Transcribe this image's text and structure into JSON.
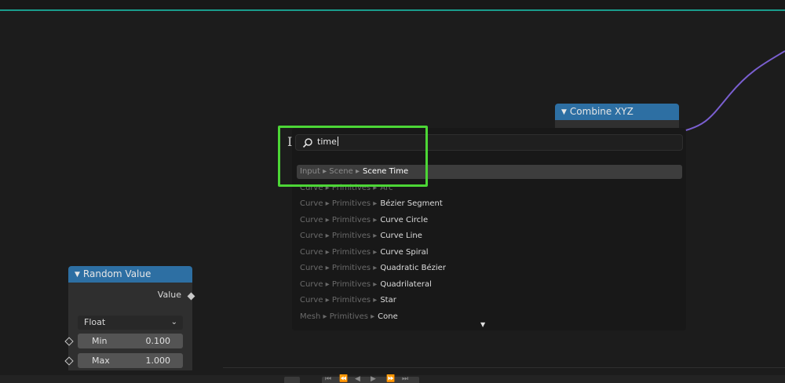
{
  "colors": {
    "node_header": "#2d6fa3",
    "highlight": "#4cd636",
    "wire": "#7a5fd0",
    "teal_line": "#1a9c8c"
  },
  "combine_node": {
    "title": "Combine XYZ",
    "icon": "chevron-down-icon"
  },
  "search": {
    "icon": "search-icon",
    "query": "time",
    "results": [
      {
        "path": "Input ▸ Scene ▸",
        "name": "Scene Time",
        "active": true
      },
      {
        "path": "Curve ▸ Primitives ▸",
        "name": "Arc"
      },
      {
        "path": "Curve ▸ Primitives ▸",
        "name": "Bézier Segment"
      },
      {
        "path": "Curve ▸ Primitives ▸",
        "name": "Curve Circle"
      },
      {
        "path": "Curve ▸ Primitives ▸",
        "name": "Curve Line"
      },
      {
        "path": "Curve ▸ Primitives ▸",
        "name": "Curve Spiral"
      },
      {
        "path": "Curve ▸ Primitives ▸",
        "name": "Quadratic Bézier"
      },
      {
        "path": "Curve ▸ Primitives ▸",
        "name": "Quadrilateral"
      },
      {
        "path": "Curve ▸ Primitives ▸",
        "name": "Star"
      },
      {
        "path": "Mesh ▸ Primitives ▸",
        "name": "Cone"
      }
    ],
    "more_icon": "▼"
  },
  "random_node": {
    "title": "Random Value",
    "output_label": "Value",
    "data_type": "Float",
    "min_label": "Min",
    "min_value": "0.100",
    "max_label": "Max",
    "max_value": "1.000"
  },
  "playback": {
    "icons": [
      "record-icon",
      "jump-start-icon",
      "prev-keyframe-icon",
      "play-reverse-icon",
      "play-icon",
      "next-keyframe-icon",
      "jump-end-icon"
    ]
  }
}
